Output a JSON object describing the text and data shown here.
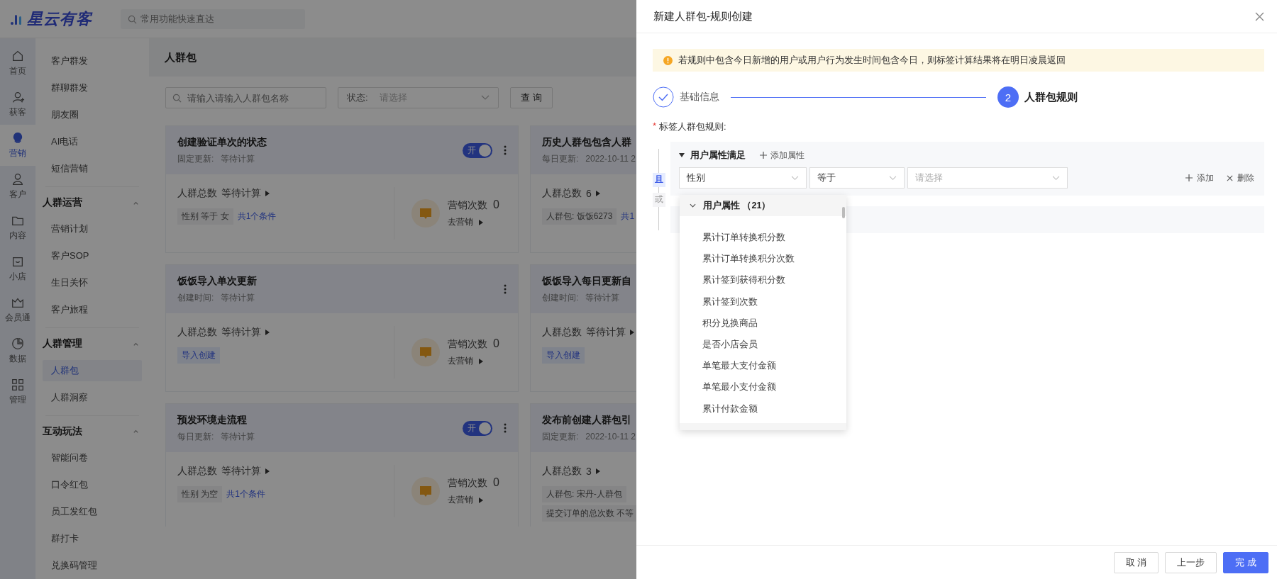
{
  "brand": {
    "name": "星云有客"
  },
  "top_search": {
    "placeholder": "常用功能快速直达"
  },
  "nav_rail": [
    {
      "label": "首页",
      "selected": false
    },
    {
      "label": "获客",
      "selected": false
    },
    {
      "label": "营销",
      "selected": true
    },
    {
      "label": "客户",
      "selected": false
    },
    {
      "label": "内容",
      "selected": false
    },
    {
      "label": "小店",
      "selected": false
    },
    {
      "label": "会员通",
      "selected": false
    },
    {
      "label": "数据",
      "selected": false
    },
    {
      "label": "管理",
      "selected": false
    }
  ],
  "submenu": [
    {
      "kind": "item",
      "label": "客户群发",
      "selected": false
    },
    {
      "kind": "item",
      "label": "群聊群发",
      "selected": false
    },
    {
      "kind": "item",
      "label": "朋友圈",
      "selected": false
    },
    {
      "kind": "item",
      "label": "AI电话",
      "selected": false
    },
    {
      "kind": "item",
      "label": "短信营销",
      "selected": false
    },
    {
      "kind": "group",
      "label": "人群运营",
      "expanded": true
    },
    {
      "kind": "item",
      "label": "营销计划",
      "selected": false
    },
    {
      "kind": "item",
      "label": "客户SOP",
      "selected": false
    },
    {
      "kind": "item",
      "label": "生日关怀",
      "selected": false
    },
    {
      "kind": "item",
      "label": "客户旅程",
      "selected": false
    },
    {
      "kind": "group",
      "label": "人群管理",
      "expanded": true
    },
    {
      "kind": "item",
      "label": "人群包",
      "selected": true
    },
    {
      "kind": "item",
      "label": "人群洞察",
      "selected": false
    },
    {
      "kind": "group",
      "label": "互动玩法",
      "expanded": true
    },
    {
      "kind": "item",
      "label": "智能问卷",
      "selected": false
    },
    {
      "kind": "item",
      "label": "口令红包",
      "selected": false
    },
    {
      "kind": "item",
      "label": "员工发红包",
      "selected": false
    },
    {
      "kind": "item",
      "label": "群打卡",
      "selected": false
    },
    {
      "kind": "item",
      "label": "兑换码管理",
      "selected": false
    }
  ],
  "page": {
    "title": "人群包",
    "search": {
      "placeholder": "请输入请输入人群包名称"
    },
    "status_filter": {
      "label": "状态:",
      "placeholder": "请选择"
    },
    "query_button": "查 询",
    "cards": [
      {
        "title": "创建验证单次的状态",
        "meta_label": "固定更新:",
        "meta_value": "等待计算",
        "toggle": {
          "on": true,
          "label": "开"
        },
        "total_label": "人群总数",
        "total_value": "等待计算",
        "tags": [
          {
            "kind": "condition",
            "text": "性别 等于 女"
          }
        ],
        "link": "共1个条件",
        "marketing": {
          "label": "营销次数",
          "count": "0",
          "action": "去营销"
        }
      },
      {
        "title": "历史人群包包含人群",
        "meta_label": "每日更新:",
        "meta_value": "2022-10-11 2",
        "total_label": "人群总数",
        "total_value": "6",
        "tags": [
          {
            "kind": "condition",
            "text": "人群包: 饭饭6273"
          }
        ],
        "link": "共1"
      },
      {
        "title": "饭饭导入单次更新",
        "meta_label": "创建时间:",
        "meta_value": "等待计算",
        "total_label": "人群总数",
        "total_value": "等待计算",
        "tags": [
          {
            "kind": "import",
            "text": "导入创建"
          }
        ],
        "marketing": {
          "label": "营销次数",
          "count": "0",
          "action": "去营销"
        }
      },
      {
        "title": "饭饭导入每日更新自",
        "meta_label": "创建时间:",
        "meta_value": "等待计算",
        "total_label": "人群总数",
        "total_value": "等待计算",
        "tags": [
          {
            "kind": "import",
            "text": "导入创建"
          }
        ]
      },
      {
        "title": "预发环境走流程",
        "meta_label": "每日更新:",
        "meta_value": "等待计算",
        "toggle": {
          "on": true,
          "label": "开"
        },
        "total_label": "人群总数",
        "total_value": "等待计算",
        "tags": [
          {
            "kind": "condition",
            "text": "性别 为空"
          }
        ],
        "link": "共1个条件",
        "marketing": {
          "label": "营销次数",
          "count": "0",
          "action": "去营销"
        }
      },
      {
        "title": "发布前创建人群包引",
        "meta_label": "固定更新:",
        "meta_value": "2022-10-11 2",
        "total_label": "人群总数",
        "total_value": "3",
        "tags": [
          {
            "kind": "condition",
            "text": "人群包: 宋丹-人群包"
          },
          {
            "kind": "condition",
            "text": "提交订单的总次数 不等"
          }
        ]
      }
    ]
  },
  "drawer": {
    "title": "新建人群包-规则创建",
    "alert": "若规则中包含今日新增的用户或用户行为发生时间包含今日，则标签计算结果将在明日凌晨返回",
    "steps": [
      {
        "label": "基础信息",
        "completed": true
      },
      {
        "label": "人群包规则",
        "completed": false,
        "number": "2"
      }
    ],
    "rule_label": {
      "mark": "*",
      "text": "标签人群包规则:"
    },
    "logic": [
      {
        "label": "且",
        "selected": true
      },
      {
        "label": "或",
        "selected": false
      }
    ],
    "group": {
      "title": "用户属性满足",
      "expanded": true,
      "add_attribute": "添加属性",
      "condition": {
        "field": "性别",
        "operator": "等于",
        "value_placeholder": "请选择"
      },
      "add": "添加",
      "delete": "删除"
    },
    "dropdown": {
      "group": "用户属性 （21）",
      "expanded": true,
      "items": [
        "累计订单转换积分数",
        "累计订单转换积分次数",
        "累计签到获得积分数",
        "累计签到次数",
        "积分兑换商品",
        "是否小店会员",
        "单笔最大支付金额",
        "单笔最小支付金额",
        "累计付款金额"
      ]
    },
    "footer": {
      "buttons": [
        {
          "label": "取 消",
          "kind": "default"
        },
        {
          "label": "上一步",
          "kind": "default"
        },
        {
          "label": "完 成",
          "kind": "primary"
        }
      ]
    }
  }
}
